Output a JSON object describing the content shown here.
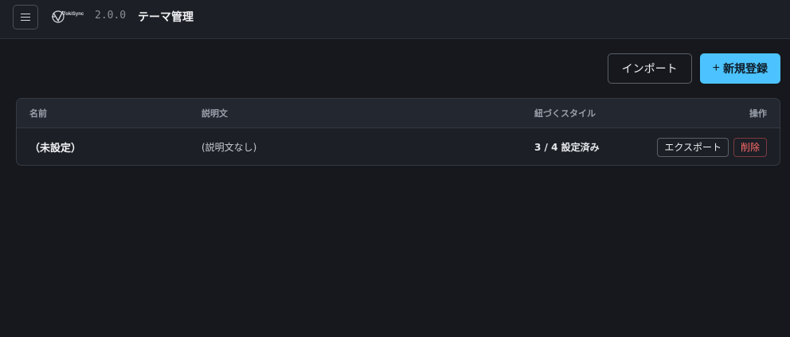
{
  "header": {
    "logo_text": "TokiSync",
    "version": "2.0.0",
    "title": "テーマ管理"
  },
  "actions": {
    "import_label": "インポート",
    "new_label": "新規登録",
    "new_prefix": "+"
  },
  "table": {
    "columns": {
      "name": "名前",
      "description": "説明文",
      "styles": "紐づくスタイル",
      "operations": "操作"
    },
    "rows": [
      {
        "name": "（未設定）",
        "description": "(説明文なし)",
        "styles": "3 / 4 設定済み",
        "export_label": "エクスポート",
        "delete_label": "削除"
      }
    ]
  },
  "colors": {
    "primary": "#4cc3ff",
    "danger": "#ff6b6b",
    "background": "#16181d"
  }
}
